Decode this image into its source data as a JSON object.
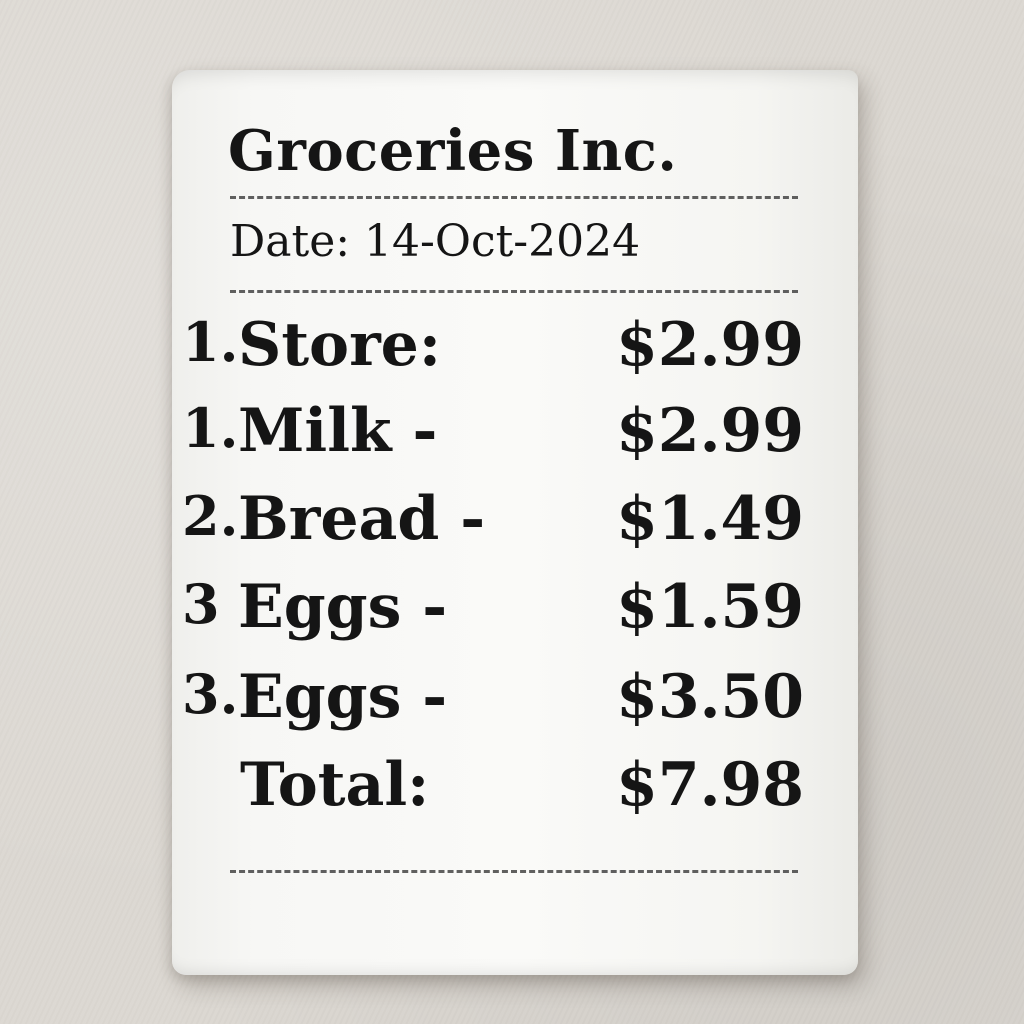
{
  "receipt": {
    "store_name": "Groceries Inc.",
    "date_line": "Date: 14-Oct-2024",
    "items": [
      {
        "num": "1.",
        "label": "Store:",
        "price": "$2.99"
      },
      {
        "num": "1.",
        "label": "Milk -",
        "price": "$2.99"
      },
      {
        "num": "2.",
        "label": "Bread -",
        "price": "$1.49"
      },
      {
        "num": "3",
        "label": "Eggs -",
        "price": "$1.59"
      },
      {
        "num": "3.",
        "label": "Eggs -",
        "price": "$3.50"
      }
    ],
    "total": {
      "label": "Total:",
      "price": "$7.98"
    }
  }
}
